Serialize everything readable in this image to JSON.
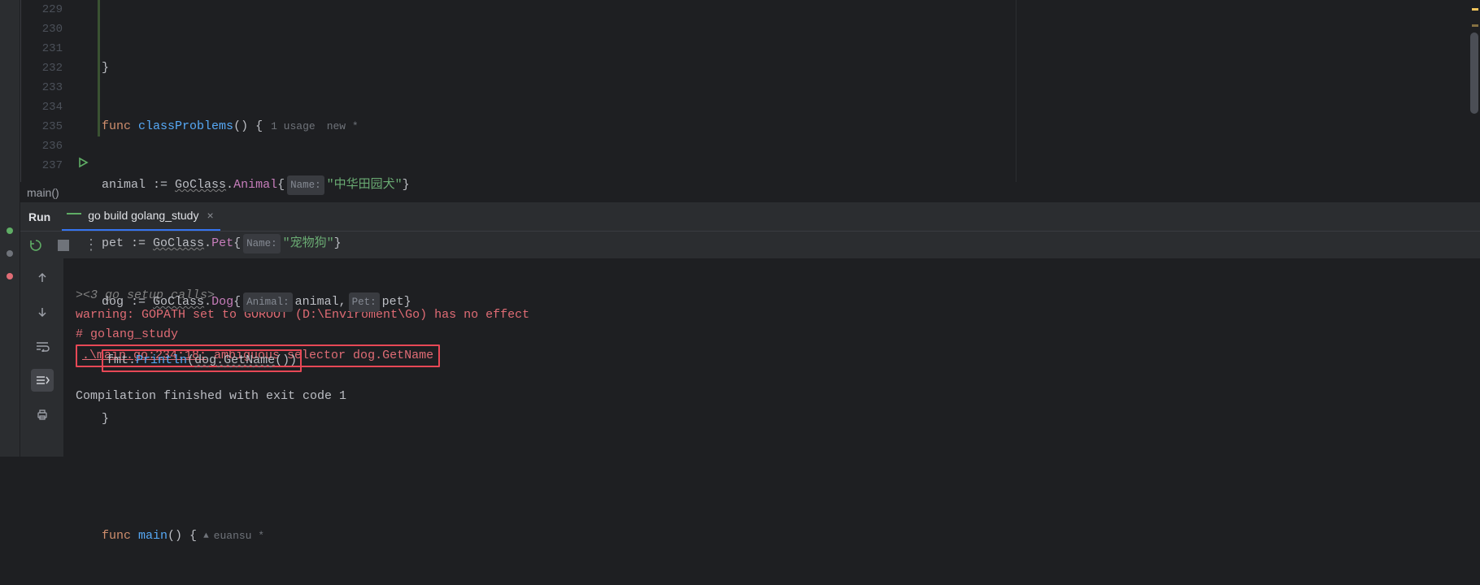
{
  "editor": {
    "line_numbers": [
      "229",
      "230",
      "231",
      "232",
      "233",
      "234",
      "235",
      "236",
      "237"
    ],
    "l229": {
      "brace": "}"
    },
    "l230": {
      "kw": "func",
      "fn": "classProblems",
      "paren": "() {",
      "usage": "1 usage",
      "mod": "new *"
    },
    "l231": {
      "v": "animal",
      "op": " := ",
      "pkg": "GoClass",
      "dot": ".",
      "typ": "Animal",
      "br": "{",
      "hint": "Name:",
      "str": "\"中华田园犬\"",
      "end": "}"
    },
    "l232": {
      "v": "pet",
      "op": " := ",
      "pkg": "GoClass",
      "dot": ".",
      "typ": "Pet",
      "br": "{",
      "hint": "Name:",
      "str": "\"宠物狗\"",
      "end": "}"
    },
    "l233": {
      "v": "dog",
      "op": " := ",
      "pkg": "GoClass",
      "dot": ".",
      "typ": "Dog",
      "br": "{",
      "hint1": "Animal:",
      "arg1": "animal,",
      "hint2": "Pet:",
      "arg2": "pet}"
    },
    "l234": {
      "pkg": "fmt",
      "dot": ".",
      "fn": "Println",
      "open": "(",
      "obj": "dog.",
      "meth": "GetName",
      "close": "())"
    },
    "l235": {
      "brace": "}"
    },
    "l236": {
      "blank": ""
    },
    "l237": {
      "kw": "func",
      "fn": "main",
      "paren": "() {",
      "author": "euansu *"
    }
  },
  "breadcrumb": "main()",
  "run_panel": {
    "label": "Run",
    "tab": "go build golang_study"
  },
  "console": {
    "l1": "<3 go setup calls>",
    "l2": "warning: GOPATH set to GOROOT (D:\\Enviroment\\Go) has no effect",
    "l3": "# golang_study",
    "l4a": ".\\main.go:234:18:",
    "l4b": " ambiguous selector dog.GetName",
    "l6": "Compilation finished with exit code 1"
  }
}
